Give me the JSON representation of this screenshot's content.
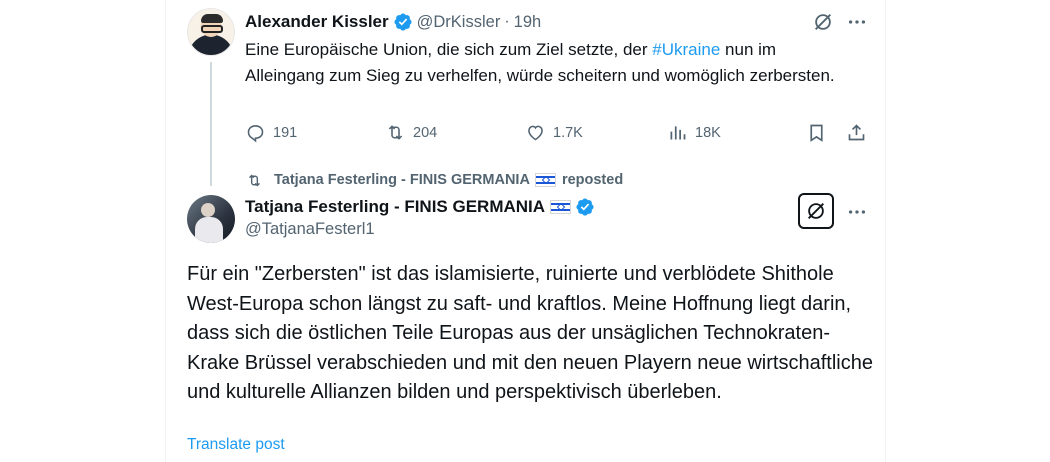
{
  "parent_tweet": {
    "author_name": "Alexander Kissler",
    "handle": "@DrKissler",
    "separator": "·",
    "time": "19h",
    "text_before": "Eine Europäische Union, die sich zum Ziel setzte, der ",
    "hashtag": "#Ukraine",
    "text_after": "  nun im Alleingang zum Sieg zu verhelfen, würde scheitern und womöglich zerbersten.",
    "replies": "191",
    "reposts": "204",
    "likes": "1.7K",
    "views": "18K"
  },
  "repost_banner": {
    "reposter": "Tatjana Festerling - FINIS GERMANIA",
    "suffix": "reposted"
  },
  "main_tweet": {
    "author_name": "Tatjana Festerling - FINIS GERMANIA",
    "handle": "@TatjanaFesterl1",
    "text": "Für ein \"Zerbersten\" ist das islamisierte, ruinierte und verblödete Shithole West-Europa schon längst zu saft- und kraftlos. Meine Hoffnung liegt darin, dass sich die östlichen Teile Europas aus der unsäglichen Technokraten-Krake Brüssel verabschieden und mit den neuen Playern neue wirtschaftliche und kulturelle Allianzen bilden und perspektivisch überleben.",
    "translate_label": "Translate post"
  },
  "icons": {
    "verified": "verified-badge-icon",
    "grok": "grok-icon",
    "more": "more-icon",
    "reply": "reply-icon",
    "repost": "repost-icon",
    "like": "heart-icon",
    "views": "views-icon",
    "bookmark": "bookmark-icon",
    "share": "share-icon",
    "flag": "israel-flag-icon"
  },
  "colors": {
    "text": "#0f1419",
    "secondary": "#536471",
    "link": "#1d9bf0",
    "verified": "#1d9bf0",
    "thread_line": "#cfd9de"
  }
}
